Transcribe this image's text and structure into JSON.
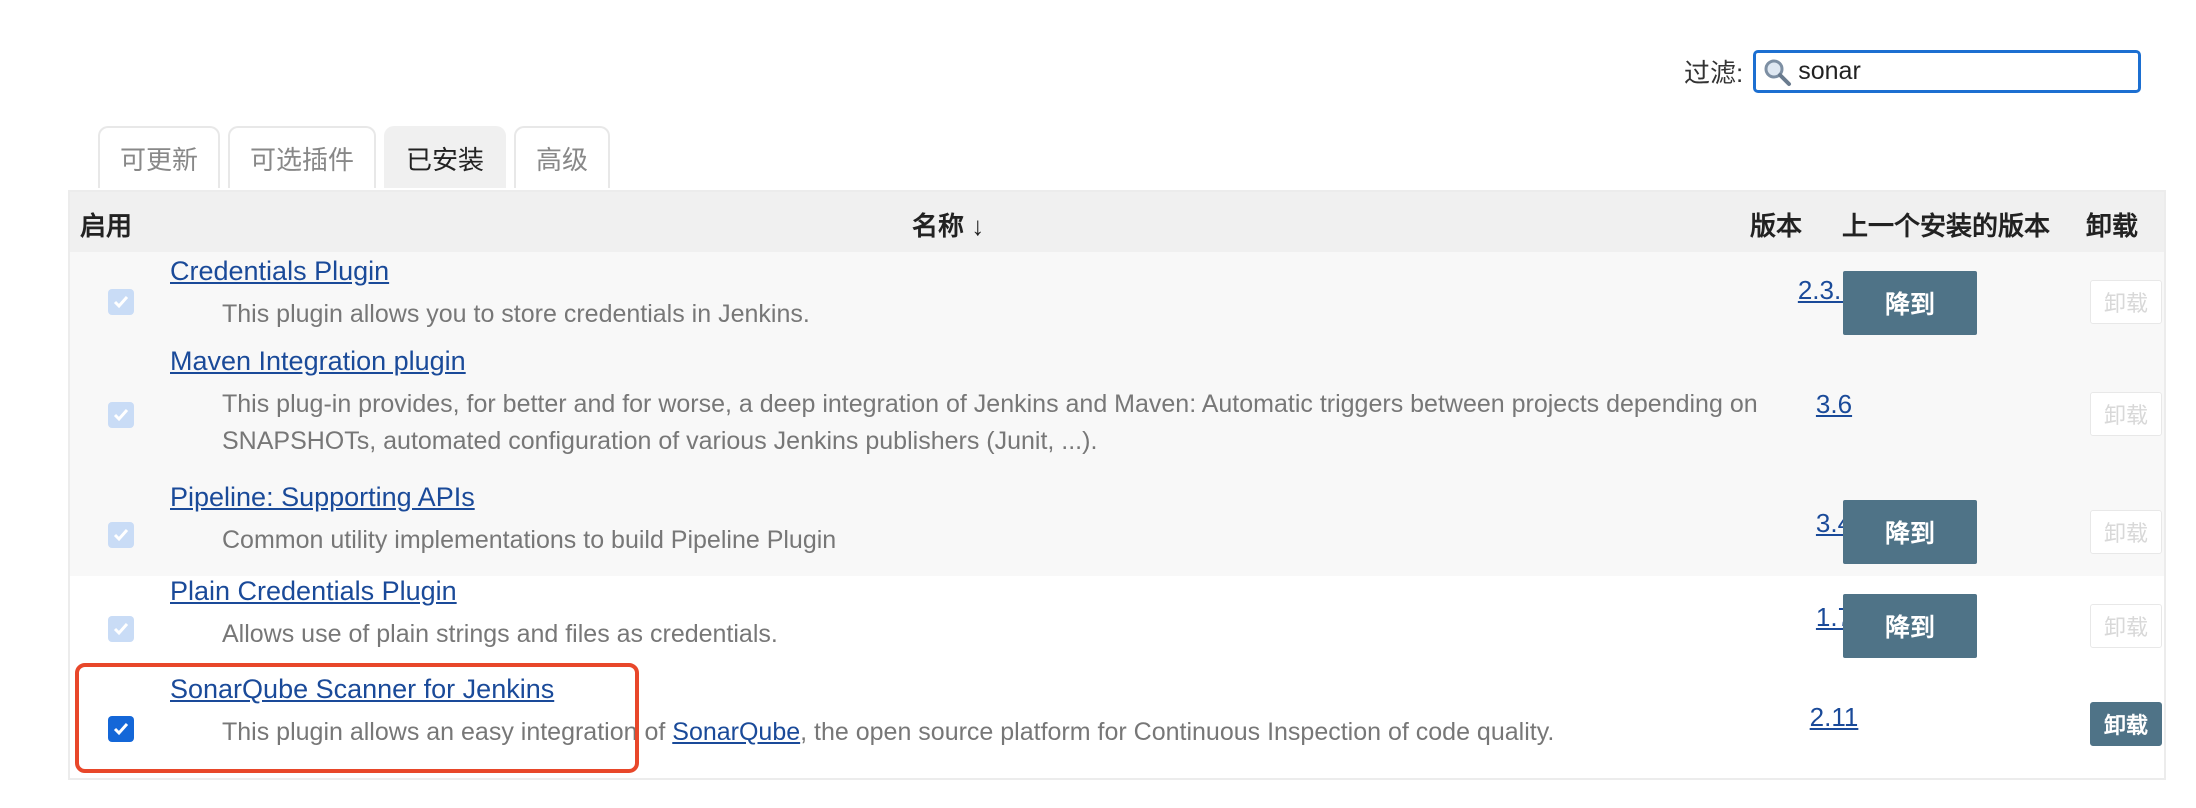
{
  "filter": {
    "label": "过滤:",
    "value": "sonar"
  },
  "tabs": [
    {
      "label": "可更新"
    },
    {
      "label": "可选插件"
    },
    {
      "label": "已安装",
      "active": true
    },
    {
      "label": "高级"
    }
  ],
  "table": {
    "headers": {
      "enabled": "启用",
      "name": "名称 ↓",
      "version": "版本",
      "previous": "上一个安装的版本",
      "uninstall": "卸载"
    },
    "rows": [
      {
        "name": "Credentials Plugin",
        "desc": "This plugin allows you to store credentials in Jenkins.",
        "version": "2.3.10",
        "downgrade": "降到",
        "uninstall": "卸载",
        "checked": true
      },
      {
        "name": "Maven Integration plugin",
        "desc": "This plug-in provides, for better and for worse, a deep integration of Jenkins and Maven: Automatic triggers between projects depending on SNAPSHOTs, automated configuration of various Jenkins publishers (Junit, ...).",
        "version": "3.6",
        "uninstall": "卸载",
        "checked": true
      },
      {
        "name": "Pipeline: Supporting APIs",
        "desc": "Common utility implementations to build Pipeline Plugin",
        "version": "3.4",
        "downgrade": "降到",
        "uninstall": "卸载",
        "checked": true
      },
      {
        "name": "Plain Credentials Plugin",
        "desc": "Allows use of plain strings and files as credentials.",
        "version": "1.7",
        "downgrade": "降到",
        "uninstall": "卸载",
        "checked": true
      },
      {
        "name": "SonarQube Scanner for Jenkins",
        "desc_before": "This plugin allows an easy integration of ",
        "desc_link": "SonarQube",
        "desc_after": ", the open source platform for Continuous Inspection of code quality.",
        "version": "2.11",
        "uninstall": "卸载",
        "checked": true
      }
    ]
  },
  "colors": {
    "accent": "#1c6fd1",
    "button": "#4f7387",
    "link": "#1a4a99",
    "highlight": "#e8472a"
  }
}
